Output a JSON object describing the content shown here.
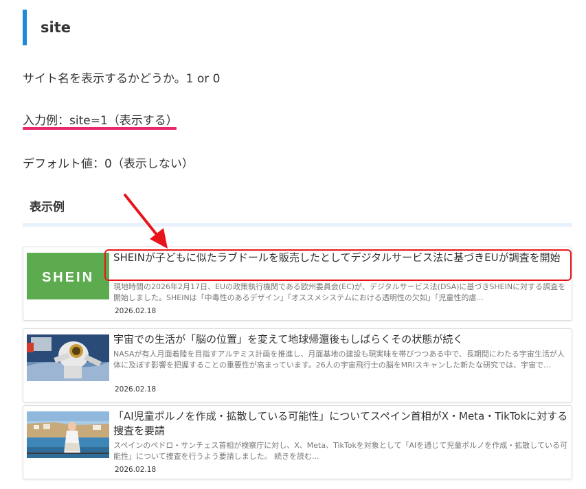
{
  "heading": "site",
  "description": "サイト名を表示するかどうか。1 or 0",
  "input_example": "入力例：site=1（表示する）",
  "default_value": "デフォルト値：0（表示しない）",
  "example_heading": "表示例",
  "colors": {
    "accent_bar": "#1e88d9",
    "underline": "#e8286d",
    "highlight": "#e8141b"
  },
  "articles": [
    {
      "title": "SHEINが子どもに似たラブドールを販売したとしてデジタルサービス法に基づきEUが調査を開始",
      "thumb_text": "SHEIN",
      "excerpt": "現地時間の2026年2月17日、EUの政策執行機関である欧州委員会(EC)が、デジタルサービス法(DSA)に基づきSHEINに対する調査を開始しました。SHEINは「中毒性のあるデザイン」「オススメシステムにおける透明性の欠如」「児童性的虐...",
      "date": "2026.02.18"
    },
    {
      "title": "宇宙での生活が「脳の位置」を変えて地球帰還後もしばらくその状態が続く",
      "excerpt": "NASAが有人月面着陸を目指すアルテミス計画を推進し、月面基地の建設も現実味を帯びつつある中で、長期間にわたる宇宙生活が人体に及ぼす影響を把握することの重要性が高まっています。26人の宇宙飛行士の脳をMRIスキャンした新たな研究では、宇宙で...",
      "date": "2026.02.18"
    },
    {
      "title": "「AI児童ポルノを作成・拡散している可能性」についてスペイン首相がX・Meta・TikTokに対する捜査を要請",
      "excerpt": "スペインのペドロ・サンチェス首相が検察庁に対し、X、Meta、TikTokを対象として「AIを通じて児童ポルノを作成・拡散している可能性」について捜査を行うよう要請しました。 続きを読む...",
      "date": "2026.02.18"
    }
  ]
}
